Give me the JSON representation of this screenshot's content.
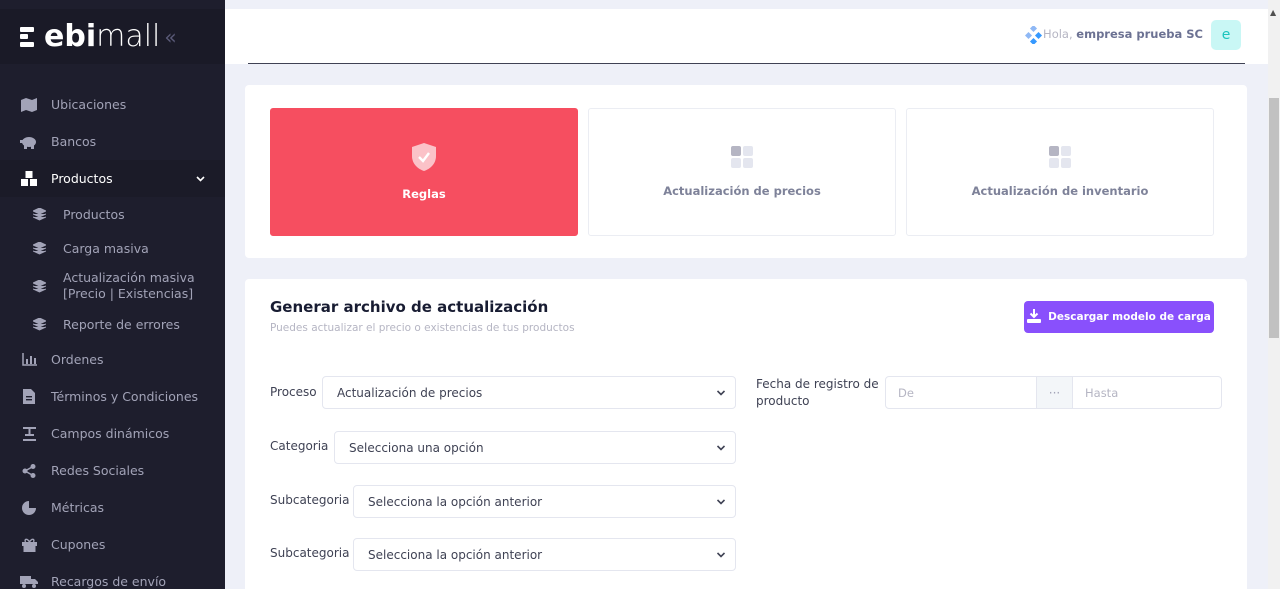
{
  "brand": {
    "bold": "ebi",
    "light": "mall",
    "collapse": "«"
  },
  "header": {
    "greeting": "Hola,",
    "user": "empresa prueba SC",
    "avatar_letter": "e"
  },
  "sidebar": {
    "items": [
      {
        "label": "Ubicaciones",
        "icon": "map-icon"
      },
      {
        "label": "Bancos",
        "icon": "piggy-bank-icon"
      },
      {
        "label": "Productos",
        "icon": "boxes-icon",
        "active": true
      },
      {
        "label": "Ordenes",
        "icon": "bar-chart-icon"
      },
      {
        "label": "Términos y Condiciones",
        "icon": "document-icon"
      },
      {
        "label": "Campos dinámicos",
        "icon": "text-format-icon"
      },
      {
        "label": "Redes Sociales",
        "icon": "share-icon"
      },
      {
        "label": "Métricas",
        "icon": "pie-chart-icon"
      },
      {
        "label": "Cupones",
        "icon": "gift-icon"
      },
      {
        "label": "Recargos de envío",
        "icon": "truck-icon"
      }
    ],
    "subitems": [
      {
        "label": "Productos"
      },
      {
        "label": "Carga masiva"
      },
      {
        "label_line1": "Actualización masiva",
        "label_line2": "[Precio | Existencias]"
      },
      {
        "label": "Reporte de errores"
      }
    ]
  },
  "tiles": [
    {
      "label": "Reglas",
      "icon": "shield-check-icon",
      "active": true
    },
    {
      "label": "Actualización de precios",
      "icon": "grid-icon"
    },
    {
      "label": "Actualización de inventario",
      "icon": "grid-icon"
    }
  ],
  "form": {
    "title": "Generar archivo de actualización",
    "subtitle": "Puedes actualizar el precio o existencias de tus productos",
    "download_label": "Descargar modelo de carga",
    "proceso_label": "Proceso",
    "proceso_value": "Actualización de precios",
    "fecha_label_1": "Fecha de registro de",
    "fecha_label_2": "producto",
    "date_from": "De",
    "date_sep": "···",
    "date_to": "Hasta",
    "categoria_label": "Categoria",
    "categoria_value": "Selecciona una opción",
    "subcat1_label": "Subcategoria",
    "subcat1_value": "Selecciona la opción anterior",
    "subcat2_label": "Subcategoria",
    "subcat2_value": "Selecciona la opción anterior"
  },
  "colors": {
    "sidebar": "#1e1e2d",
    "active_tile": "#f64e60",
    "primary_button": "#8950fc"
  }
}
